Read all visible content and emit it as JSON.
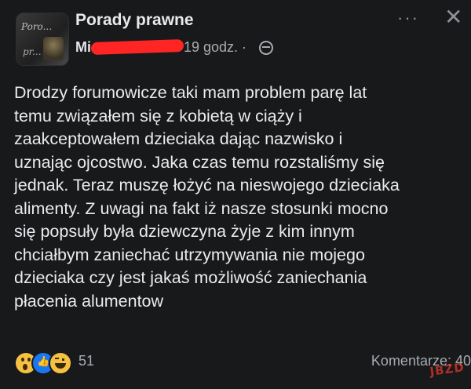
{
  "post": {
    "group_name": "Porady prawne",
    "avatar_text_top": "Poro...",
    "avatar_text_bottom": "pr...",
    "author_visible": "Mi",
    "time": "19 godz. ·",
    "body": "Drodzy forumowicze taki mam problem parę lat\ntemu związałem się z kobietą w ciąży i\nzaakceptowałem dzieciaka dając  nazwisko i\nuznając ojcostwo. Jaka czas temu rozstaliśmy się\njednak. Teraz muszę łożyć na nieswojego dzieciaka\nalimenty. Z uwagi na fakt iż nasze stosunki mocno\nsię popsuły była dziewczyna żyje z kim innym\nchciałbym zaniechać utrzymywania nie mojego\ndzieciaka czy jest jakaś możliwość zaniechania\npłacenia  alumentow",
    "more_label": "···",
    "close_label": "✕"
  },
  "footer": {
    "reaction_count": "51",
    "comments_label": "Komentarze: 40"
  },
  "watermark": "JBZD",
  "icons": [
    "wow-icon",
    "like-icon",
    "haha-icon",
    "globe-icon",
    "more-icon",
    "close-icon"
  ]
}
